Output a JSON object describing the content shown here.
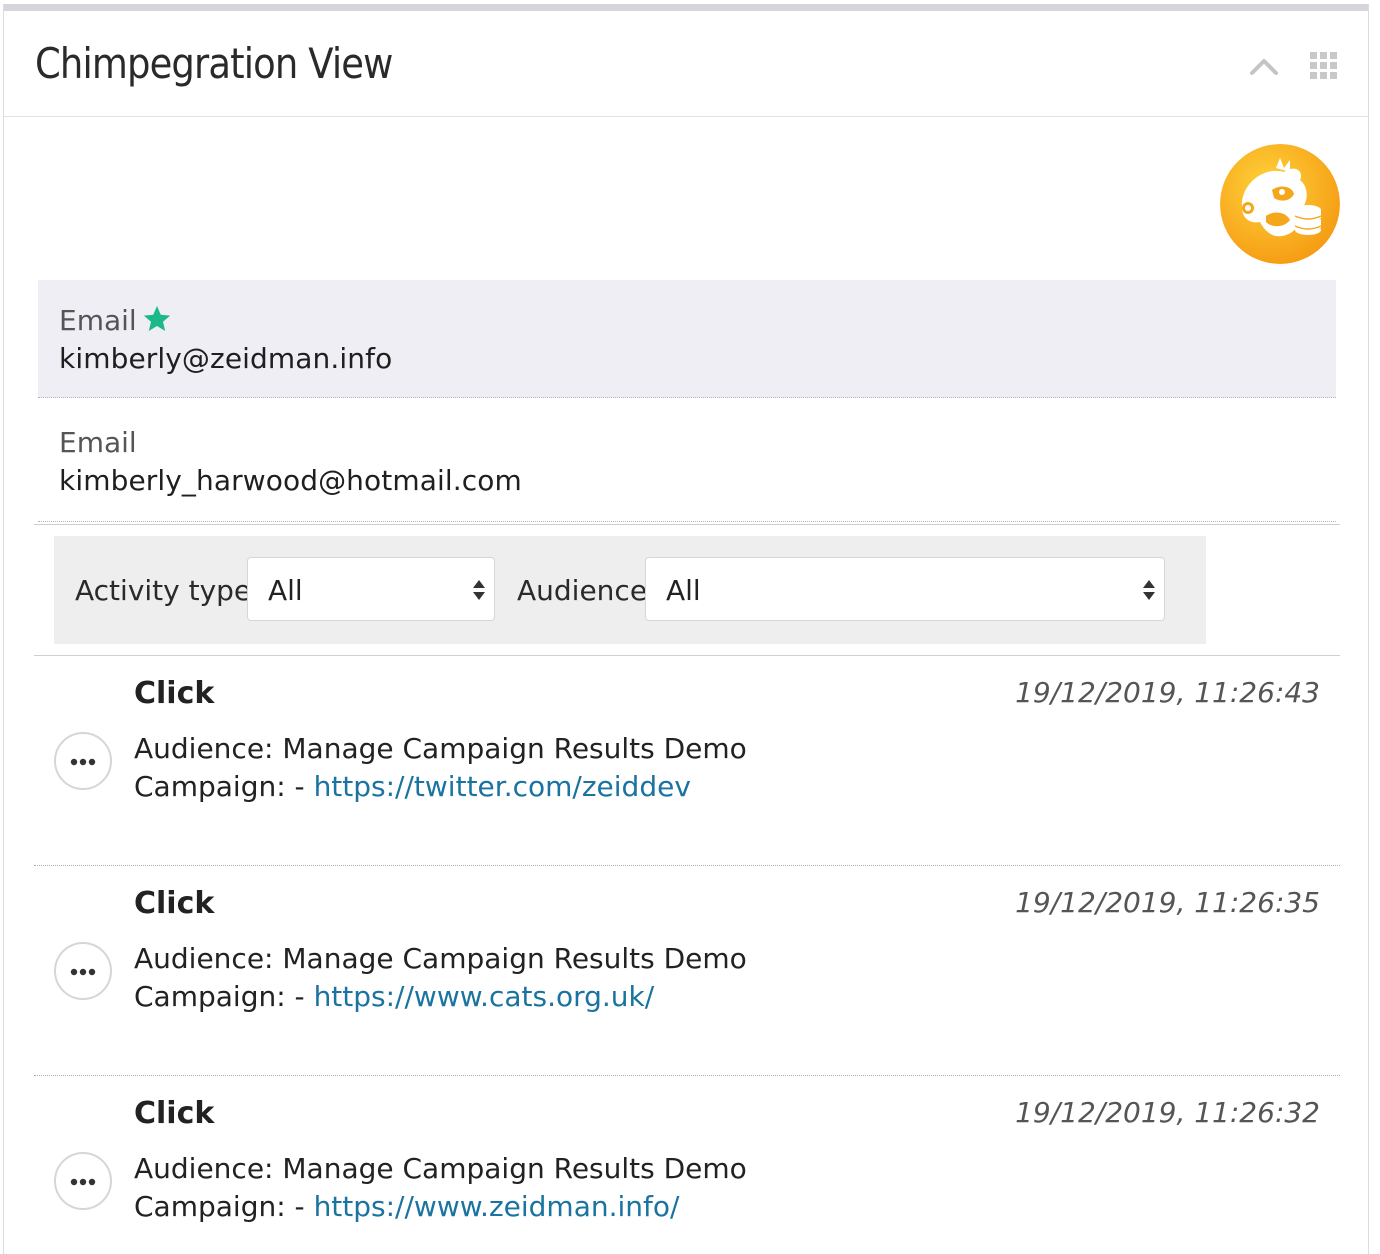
{
  "panel": {
    "title": "Chimpegration View",
    "icons": {
      "collapse": "chevron-up-icon",
      "menu": "grid-icon"
    },
    "logo_icon": "chimpegration-logo"
  },
  "emails": [
    {
      "label": "Email",
      "value": "kimberly@zeidman.info",
      "primary": true,
      "star_color": "#1db88a"
    },
    {
      "label": "Email",
      "value": "kimberly_harwood@hotmail.com",
      "primary": false
    }
  ],
  "filters": {
    "activity_type": {
      "label": "Activity type",
      "selected": "All"
    },
    "audience": {
      "label": "Audience",
      "selected": "All"
    }
  },
  "activities": [
    {
      "type": "Click",
      "timestamp": "19/12/2019, 11:26:43",
      "audience_text": "Audience: Manage Campaign Results Demo",
      "campaign_prefix": "Campaign: - ",
      "link": "https://twitter.com/zeiddev"
    },
    {
      "type": "Click",
      "timestamp": "19/12/2019, 11:26:35",
      "audience_text": "Audience: Manage Campaign Results Demo",
      "campaign_prefix": "Campaign: - ",
      "link": "https://www.cats.org.uk/"
    },
    {
      "type": "Click",
      "timestamp": "19/12/2019, 11:26:32",
      "audience_text": "Audience: Manage Campaign Results Demo",
      "campaign_prefix": "Campaign: - ",
      "link": "https://www.zeidman.info/"
    }
  ],
  "colors": {
    "link": "#1a73a0",
    "accent_star": "#1db88a",
    "logo_orange": "#f7a21b"
  }
}
